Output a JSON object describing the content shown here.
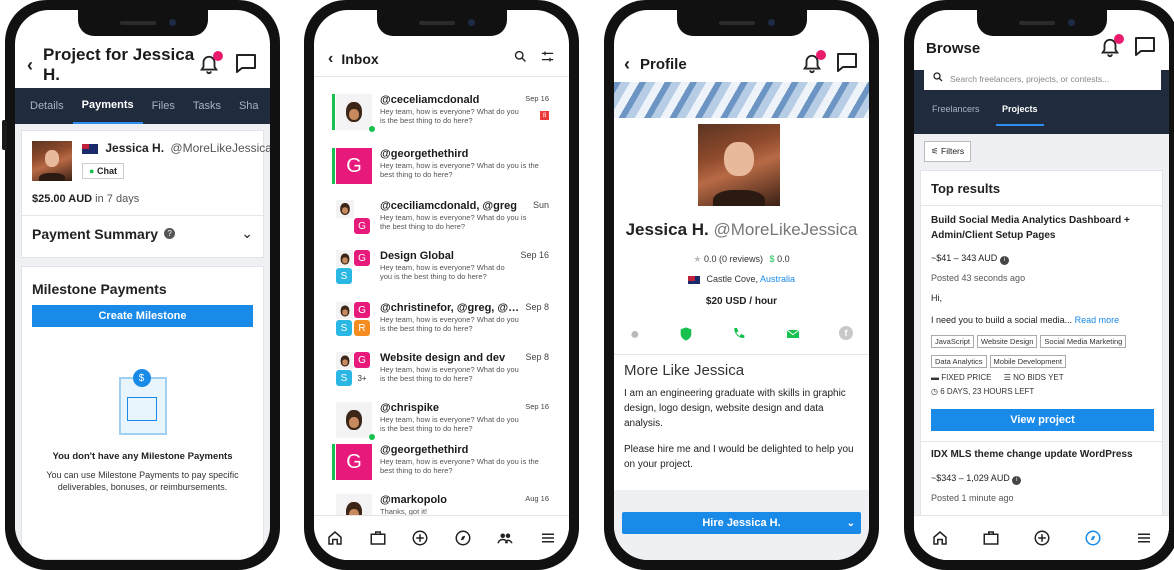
{
  "phone1": {
    "title": "Project for Jessica H.",
    "tabs": [
      "Details",
      "Payments",
      "Files",
      "Tasks",
      "Sha"
    ],
    "active_tab": 1,
    "freelancer_name": "Jessica H.",
    "freelancer_handle": "@MoreLikeJessica",
    "chat_label": "Chat",
    "bid_amount": "$25.00 AUD",
    "bid_period": " in 7 days",
    "payment_summary": "Payment Summary",
    "milestone_title": "Milestone Payments",
    "create_milestone": "Create Milestone",
    "empty_title": "You don't have any Milestone Payments",
    "empty_text": "You can use Milestone Payments to pay specific deliverables, bonuses, or reimbursements."
  },
  "phone2": {
    "title": "Inbox",
    "rows": [
      {
        "name": "@ceceliamcdonald",
        "msg": "Hey team, how is everyone? What do you is the best thing to do here?",
        "time": "Sep 16",
        "badge": "8"
      },
      {
        "name": "@georgethethird",
        "msg": "Hey team, how is everyone? What do you is the best thing to do here?",
        "time": ""
      },
      {
        "name": "@ceciliamcdonald, @greg",
        "msg": "Hey team, how is everyone? What do you is the best thing to do here?",
        "time": "Sun"
      },
      {
        "name": "Design Global",
        "msg": "Hey team, how is everyone? What do you is the best thing to do here?",
        "time": "Sep 16"
      },
      {
        "name": "@christinefor, @greg, @sele...",
        "msg": "Hey team, how is everyone? What do you is the best thing to do here?",
        "time": "Sep 8"
      },
      {
        "name": "Website design and dev",
        "msg": "Hey team, how is everyone? What do you is the best thing to do here?",
        "time": "Sep 8",
        "more": "3+"
      },
      {
        "name": "@chrispike",
        "msg": "Hey team, how is everyone? What do you is the best thing to do here?",
        "time": "Sep 16"
      },
      {
        "name": "@georgethethird",
        "msg": "Hey team, how is everyone? What do you is the best thing to do here?",
        "time": ""
      },
      {
        "name": "@markopolo",
        "msg": "Thanks, got it!",
        "time": "Aug 16"
      }
    ],
    "avatar_letters": {
      "g": "G",
      "s": "S",
      "r": "R"
    }
  },
  "phone3": {
    "title": "Profile",
    "name": "Jessica H.",
    "handle": "@MoreLikeJessica",
    "rating": "0.0",
    "reviews": "(0 reviews)",
    "earnings": "0.0",
    "location": "Castle Cove, ",
    "country": "Australia",
    "rate": "$20 USD / hour",
    "about_title": "More Like Jessica",
    "about_p1": "I am an engineering graduate with skills in graphic design, logo design, website design and data analysis.",
    "about_p2": "Please hire me and I would be delighted to help you on your project.",
    "hire_label": "Hire Jessica H."
  },
  "phone4": {
    "title": "Browse",
    "search_placeholder": "Search freelancers, projects, or contests...",
    "tabs": [
      "Freelancers",
      "Projects"
    ],
    "active_tab": 1,
    "filters": "Filters",
    "top_results": "Top results",
    "p1_title": "Build Social Media Analytics Dashboard + Admin/Client Setup Pages",
    "p1_budget": "~$41 – 343 AUD",
    "p1_posted": "Posted 43 seconds ago",
    "p1_hi": "Hi,",
    "p1_desc": "I need you to build a social media...",
    "read_more": "Read more",
    "p1_tags": [
      "JavaScript",
      "Website Design",
      "Social Media Marketing",
      "Data Analytics",
      "Mobile Development"
    ],
    "p1_fixed": "FIXED PRICE",
    "p1_bids": "NO BIDS YET",
    "p1_left": "6 DAYS, 23 HOURS LEFT",
    "view_project": "View project",
    "p2_title": "IDX MLS theme change update WordPress",
    "p2_budget": "~$343 – 1,029 AUD",
    "p2_posted": "Posted 1 minute ago"
  },
  "colors": {
    "accent": "#1a8ae9",
    "badge": "#ea1a6d",
    "navy": "#202c3e",
    "green": "#18c04f"
  }
}
